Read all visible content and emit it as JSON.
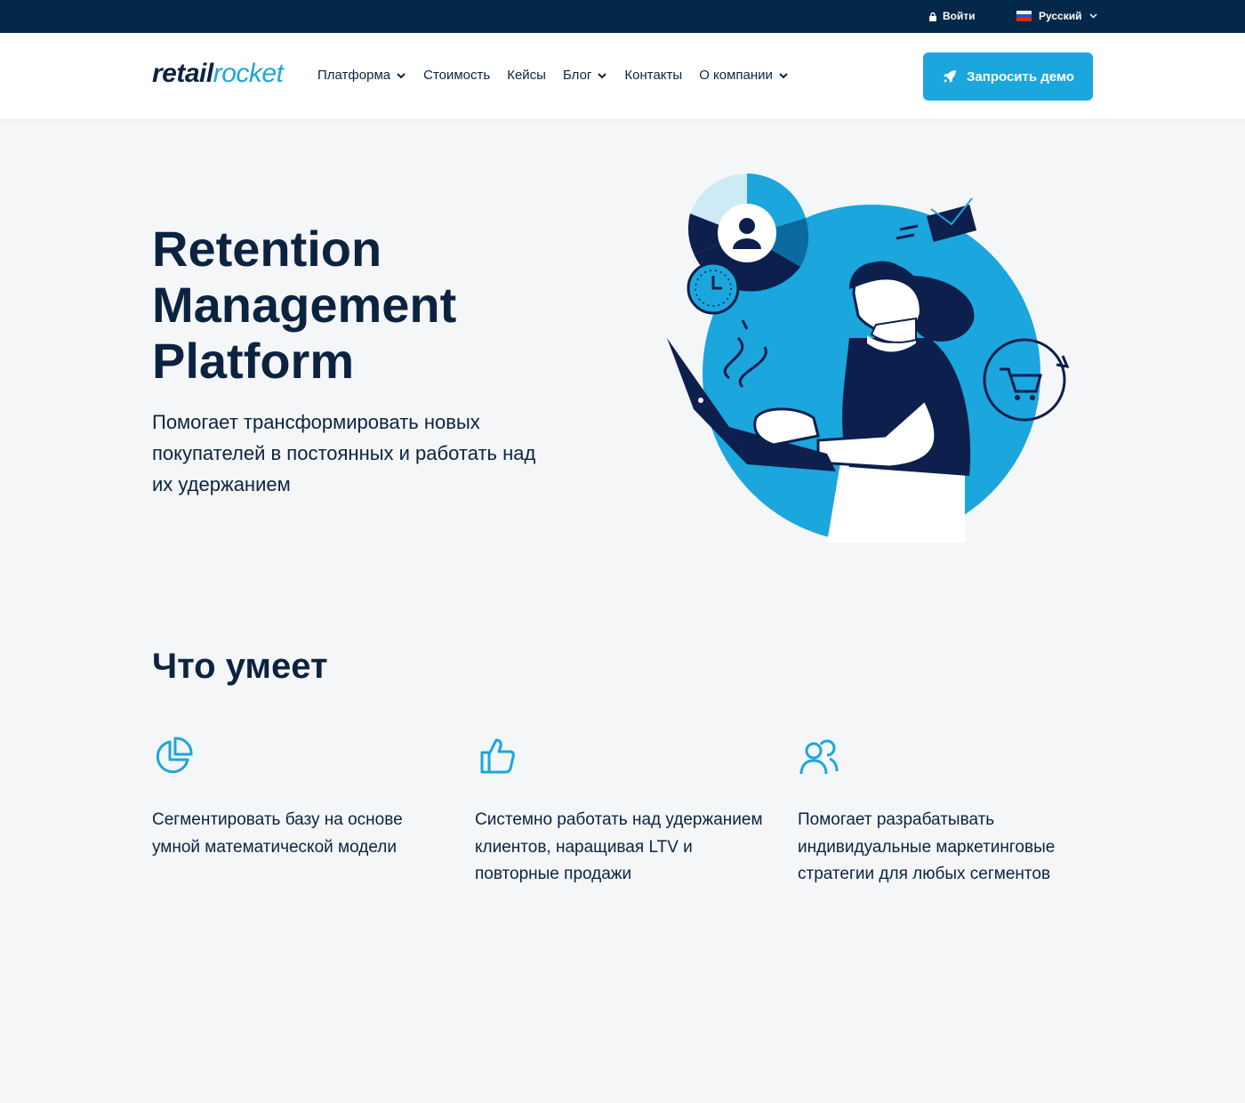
{
  "topbar": {
    "login_label": "Войти",
    "language_label": "Русский"
  },
  "header": {
    "logo_part1": "retail",
    "logo_part2": "rocket",
    "nav": [
      {
        "label": "Платформа",
        "dropdown": true
      },
      {
        "label": "Стоимость",
        "dropdown": false
      },
      {
        "label": "Кейсы",
        "dropdown": false
      },
      {
        "label": "Блог",
        "dropdown": true
      },
      {
        "label": "Контакты",
        "dropdown": false
      },
      {
        "label": "О компании",
        "dropdown": true
      }
    ],
    "demo_button_label": "Запросить демо"
  },
  "hero": {
    "title": "Retention Management Platform",
    "subtitle": "Помогает трансформировать новых покупателей в постоянных и работать над их удержанием"
  },
  "features_section": {
    "title": "Что умеет",
    "items": [
      {
        "icon": "pie-chart-icon",
        "text": "Сегментировать базу на основе умной математической модели"
      },
      {
        "icon": "thumbs-up-icon",
        "text": "Системно работать над удержанием клиентов, наращивая LTV и повторные продажи"
      },
      {
        "icon": "users-icon",
        "text": "Помогает разрабатывать индивидуальные маркетинговые стратегии для любых сегментов"
      }
    ]
  },
  "colors": {
    "accent": "#1ba6dd",
    "navy": "#0c2340",
    "topbar": "#04284a",
    "background": "#f4f6f8"
  }
}
